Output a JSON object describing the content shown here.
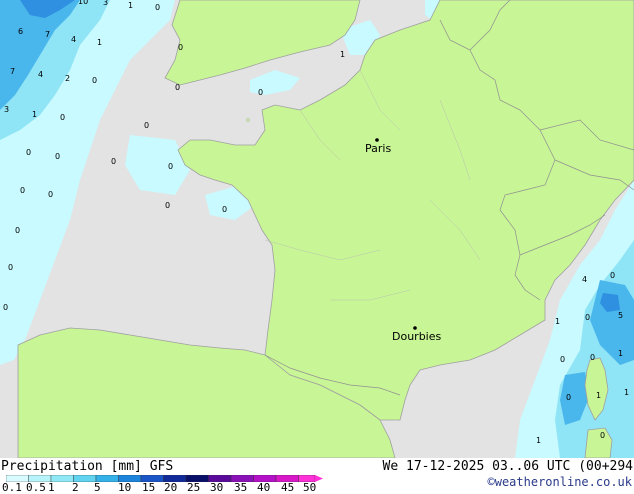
{
  "map": {
    "cities": [
      {
        "name": "Paris"
      },
      {
        "name": "Dourbies"
      }
    ],
    "cell_values": [
      "10",
      "3",
      "1",
      "0",
      "6",
      "7",
      "4",
      "1",
      "7",
      "4",
      "2",
      "0",
      "3",
      "1",
      "0",
      "0",
      "0",
      "0",
      "0",
      "0",
      "0",
      "0",
      "0",
      "0",
      "0",
      "0",
      "0",
      "0",
      "0",
      "0",
      "1",
      "4",
      "0",
      "1",
      "0",
      "5",
      "0",
      "0",
      "1",
      "0",
      "1",
      "1",
      "1",
      "0"
    ]
  },
  "footer": {
    "legend_title": "Precipitation [mm]  GFS",
    "run_info": "We 17-12-2025 03..06 UTC (00+294",
    "credit": "©weatheronline.co.uk"
  },
  "legend": {
    "ticks": [
      "0.1",
      "0.5",
      "1",
      "2",
      "5",
      "10",
      "15",
      "20",
      "25",
      "30",
      "35",
      "40",
      "45",
      "50"
    ],
    "colors": [
      "#d8fbff",
      "#b6f3fa",
      "#8ee8f6",
      "#5fd3f0",
      "#35b1ea",
      "#1c84dc",
      "#1a55c8",
      "#102a9a",
      "#08106a",
      "#5a0a9a",
      "#8a10b8",
      "#b410c8",
      "#d818c8",
      "#ff30d8"
    ]
  },
  "colors": {
    "land_france": "#c8f596",
    "land_uk": "#c8f596",
    "background": "#e6e6e6",
    "precip_light": "#c8faff",
    "precip_mid": "#7ad6f0",
    "precip_heavy": "#3aa4e6"
  }
}
